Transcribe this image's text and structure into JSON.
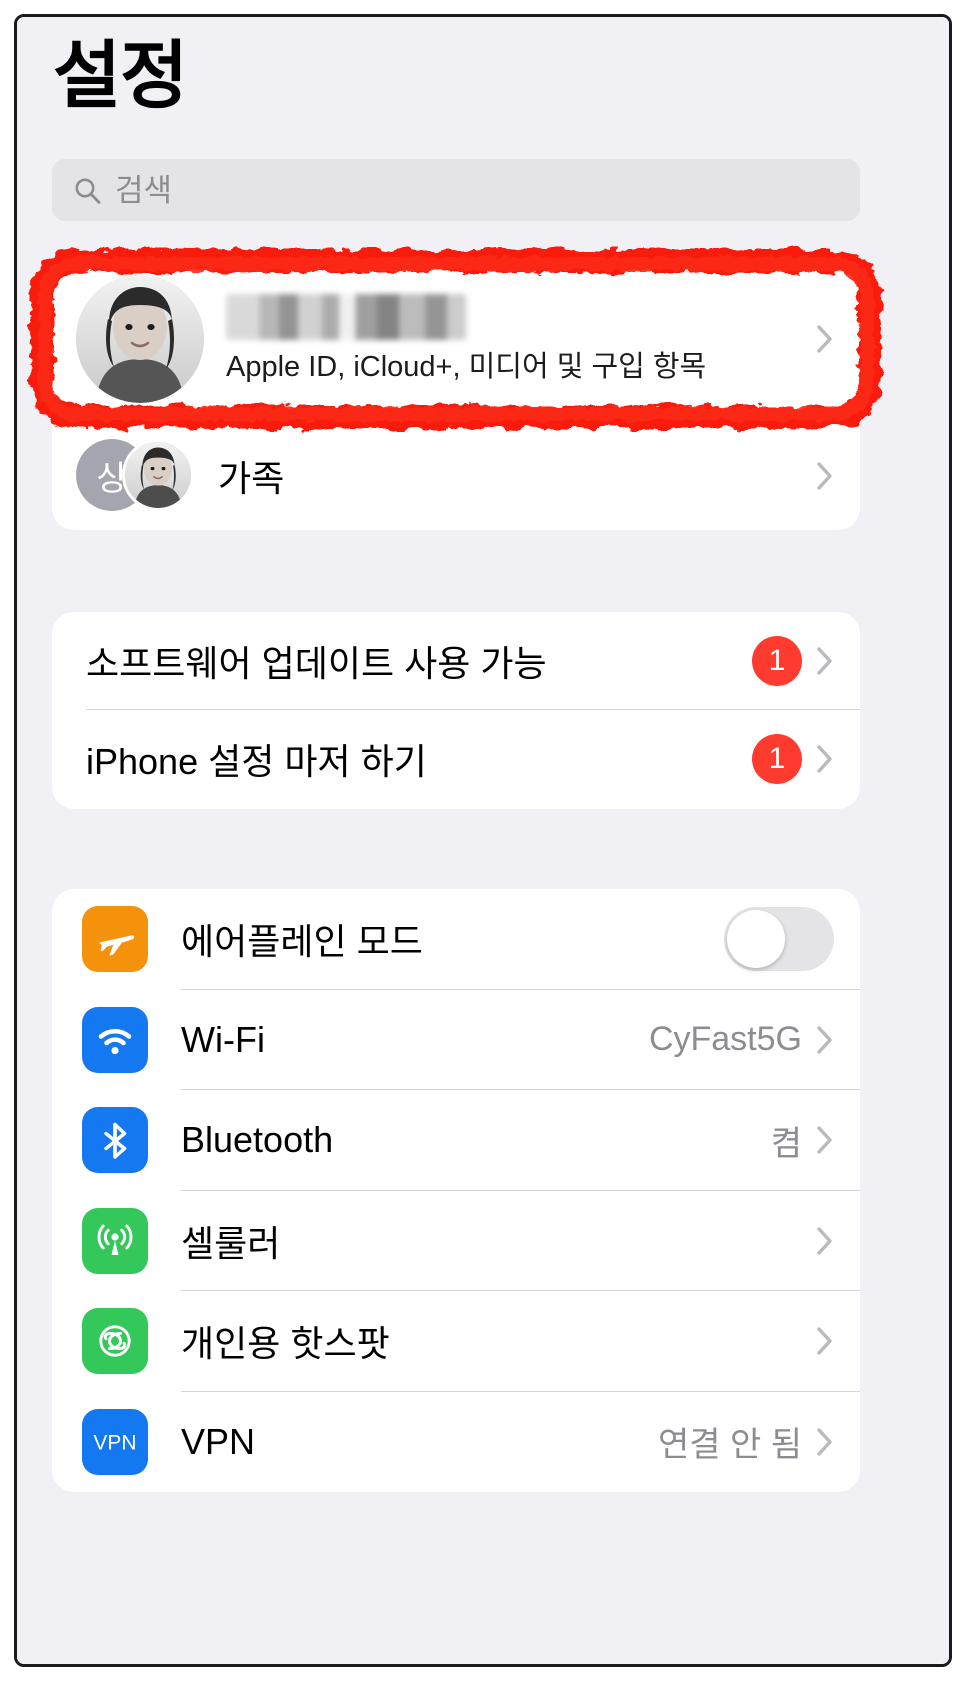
{
  "header": {
    "title": "설정"
  },
  "search": {
    "placeholder": "검색",
    "icon": "search-icon"
  },
  "account": {
    "name_redacted": "",
    "subtitle": "Apple ID, iCloud+, 미디어 및 구입 항목",
    "avatar": "user-avatar-photo",
    "chevron": "chevron-right-icon",
    "highlighted": true,
    "highlight_color": "#f91b0c"
  },
  "family": {
    "label": "가족",
    "initial_avatar": "상",
    "chevron": "chevron-right-icon"
  },
  "updates": [
    {
      "label": "소프트웨어 업데이트 사용 가능",
      "badge": "1",
      "badge_color": "#ff3b30",
      "chevron": "chevron-right-icon"
    },
    {
      "label": "iPhone 설정 마저 하기",
      "badge": "1",
      "badge_color": "#ff3b30",
      "chevron": "chevron-right-icon"
    }
  ],
  "connectivity": [
    {
      "label": "에어플레인 모드",
      "icon": "airplane-icon",
      "icon_color": "#f5920b",
      "control": "toggle",
      "toggle_on": false,
      "value": ""
    },
    {
      "label": "Wi-Fi",
      "icon": "wifi-icon",
      "icon_color": "#1478f0",
      "control": "value",
      "value": "CyFast5G",
      "chevron": "chevron-right-icon"
    },
    {
      "label": "Bluetooth",
      "icon": "bluetooth-icon",
      "icon_color": "#1478f0",
      "control": "value",
      "value": "켬",
      "chevron": "chevron-right-icon"
    },
    {
      "label": "셀룰러",
      "icon": "cellular-antenna-icon",
      "icon_color": "#34c759",
      "control": "value",
      "value": "",
      "chevron": "chevron-right-icon"
    },
    {
      "label": "개인용 핫스팟",
      "icon": "personal-hotspot-icon",
      "icon_color": "#34c759",
      "control": "value",
      "value": "",
      "chevron": "chevron-right-icon"
    },
    {
      "label": "VPN",
      "icon": "vpn-icon",
      "icon_color": "#1478f0",
      "icon_text": "VPN",
      "control": "value",
      "value": "연결 안 됨",
      "chevron": "chevron-right-icon"
    }
  ]
}
